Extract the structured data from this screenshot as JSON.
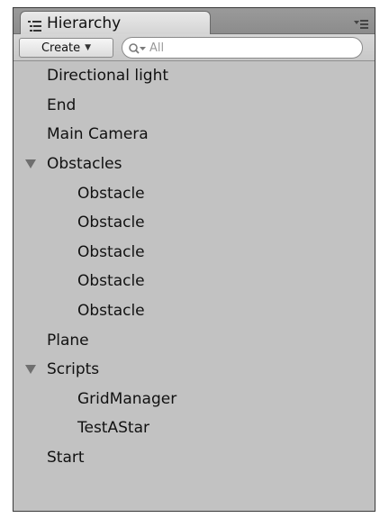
{
  "panel": {
    "tab_label": "Hierarchy",
    "tab_icon": "hierarchy-list-icon",
    "menu_icon": "panel-menu-icon"
  },
  "toolbar": {
    "create_label": "Create",
    "create_caret": "▼",
    "search_placeholder": "All",
    "search_icon": "search-dropdown-icon"
  },
  "items": [
    {
      "label": "Directional light",
      "level": 0,
      "expandable": false
    },
    {
      "label": "End",
      "level": 0,
      "expandable": false
    },
    {
      "label": "Main Camera",
      "level": 0,
      "expandable": false
    },
    {
      "label": "Obstacles",
      "level": 0,
      "expandable": true,
      "expanded": true
    },
    {
      "label": "Obstacle",
      "level": 1,
      "expandable": false
    },
    {
      "label": "Obstacle",
      "level": 1,
      "expandable": false
    },
    {
      "label": "Obstacle",
      "level": 1,
      "expandable": false
    },
    {
      "label": "Obstacle",
      "level": 1,
      "expandable": false
    },
    {
      "label": "Obstacle",
      "level": 1,
      "expandable": false
    },
    {
      "label": "Plane",
      "level": 0,
      "expandable": false
    },
    {
      "label": "Scripts",
      "level": 0,
      "expandable": true,
      "expanded": true
    },
    {
      "label": "GridManager",
      "level": 1,
      "expandable": false
    },
    {
      "label": "TestAStar",
      "level": 1,
      "expandable": false
    },
    {
      "label": "Start",
      "level": 0,
      "expandable": false
    }
  ]
}
